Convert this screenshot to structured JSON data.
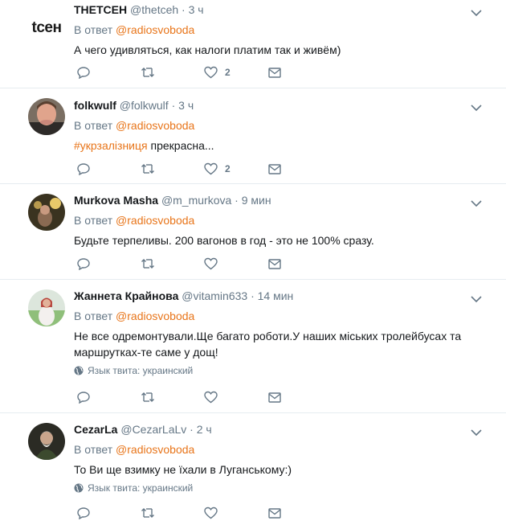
{
  "tweets": [
    {
      "name": "THETCEH",
      "handle": "@thetceh",
      "time": "3 ч",
      "reply_prefix": "В ответ",
      "reply_to": "@radiosvoboda",
      "text": "А чего удивляться, как налоги платим так и живём)",
      "likes": "2",
      "avatar_logo": "tcен"
    },
    {
      "name": "folkwulf",
      "handle": "@folkwulf",
      "time": "3 ч",
      "reply_prefix": "В ответ",
      "reply_to": "@radiosvoboda",
      "hashtag": "#укрзалізниця",
      "text": " прекрасна...",
      "likes": "2"
    },
    {
      "name": "Murkova Masha",
      "handle": "@m_murkova",
      "time": "9 мин",
      "reply_prefix": "В ответ",
      "reply_to": "@radiosvoboda",
      "text": "Будьте терпеливы. 200 вагонов в год - это не 100% сразу."
    },
    {
      "name": "Жаннета Крайнова",
      "handle": "@vitamin633",
      "time": "14 мин",
      "reply_prefix": "В ответ",
      "reply_to": "@radiosvoboda",
      "text": "Не все одремонтували.Ще багато роботи.У наших міських тролейбусах та маршрутках-те саме у дощ!",
      "language": "Язык твита: украинский"
    },
    {
      "name": "CezarLa",
      "handle": "@CezarLaLv",
      "time": "2 ч",
      "reply_prefix": "В ответ",
      "reply_to": "@radiosvoboda",
      "text": "То Ви ще взимку не їхали в Луганському:)",
      "language": "Язык твита: украинский"
    }
  ],
  "separator": "·",
  "icons": [
    "reply-icon",
    "retweet-icon",
    "like-icon",
    "message-icon",
    "chevron-down-icon",
    "globe-icon"
  ],
  "colors": {
    "link": "#e8751a",
    "muted": "#657786",
    "text": "#14171a",
    "divider": "#e6ecf0"
  }
}
